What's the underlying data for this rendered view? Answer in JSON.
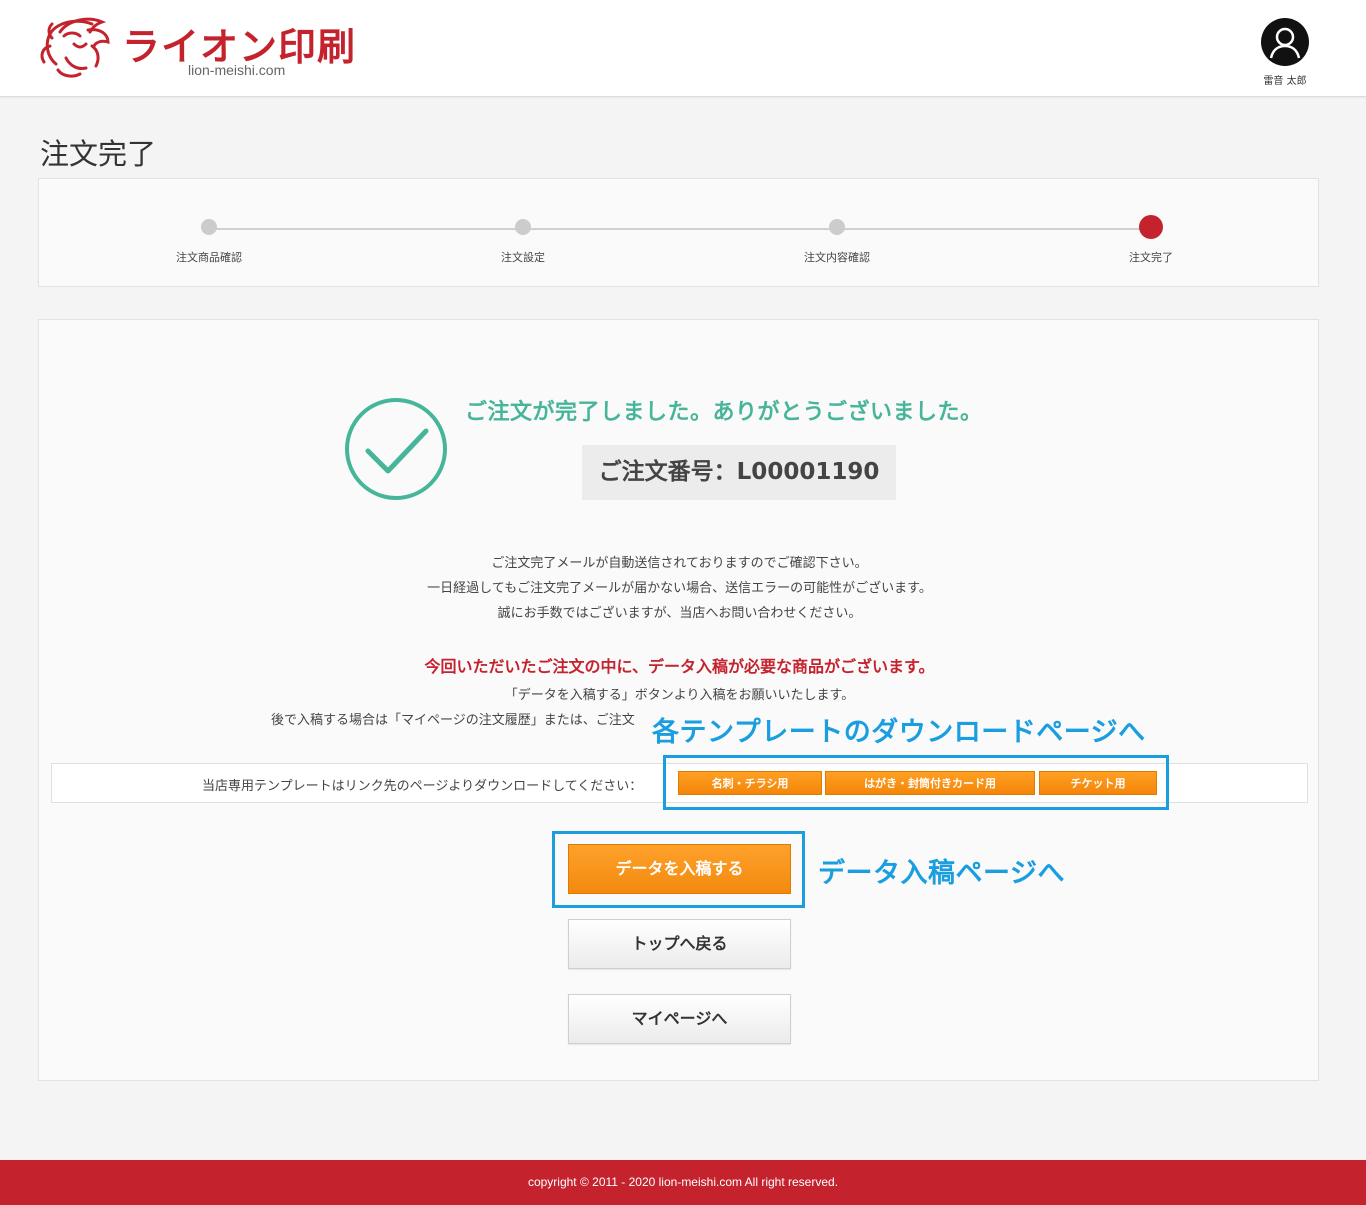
{
  "header": {
    "brand": "ライオン印刷",
    "domain": "lion-meishi.com",
    "user_name": "雷音 太郎"
  },
  "page_title": "注文完了",
  "steps": [
    {
      "label": "注文商品確認",
      "active": false
    },
    {
      "label": "注文設定",
      "active": false
    },
    {
      "label": "注文内容確認",
      "active": false
    },
    {
      "label": "注文完了",
      "active": true
    }
  ],
  "main": {
    "done_message": "ご注文が完了しました。ありがとうございました。",
    "order_number": "ご注文番号：L00001190",
    "info_lines": [
      "ご注文完了メールが自動送信されておりますのでご確認下さい。",
      "一日経過してもご注文完了メールが届かない場合、送信エラーの可能性がございます。",
      "誠にお手数ではございますが、当店へお問い合わせください。"
    ],
    "notice": "今回いただいたご注文の中に、データ入稿が必要な商品がございます。",
    "upload_lines": [
      "「データを入稿する」ボタンより入稿をお願いいたします。",
      "後で入稿する場合は「マイページの注文履歴」または、ご注文"
    ],
    "template_text": "当店専用テンプレートはリンク先のページよりダウンロードしてください：",
    "template_buttons": [
      "名刺・チラシ用",
      "はがき・封筒付きカード用",
      "チケット用"
    ],
    "upload_button": "データを入稿する",
    "top_button": "トップへ戻る",
    "mypage_button": "マイページへ"
  },
  "annotations": {
    "templates": "各テンプレートのダウンロードページへ",
    "upload": "データ入稿ページへ"
  },
  "colors": {
    "brand_red": "#c4232e",
    "success_green": "#46b59a",
    "orange": "#f28a0e",
    "annotation_blue": "#1a9ee0"
  },
  "footer": {
    "copyright": "copyright © 2011 - 2020 lion-meishi.com All right reserved."
  }
}
